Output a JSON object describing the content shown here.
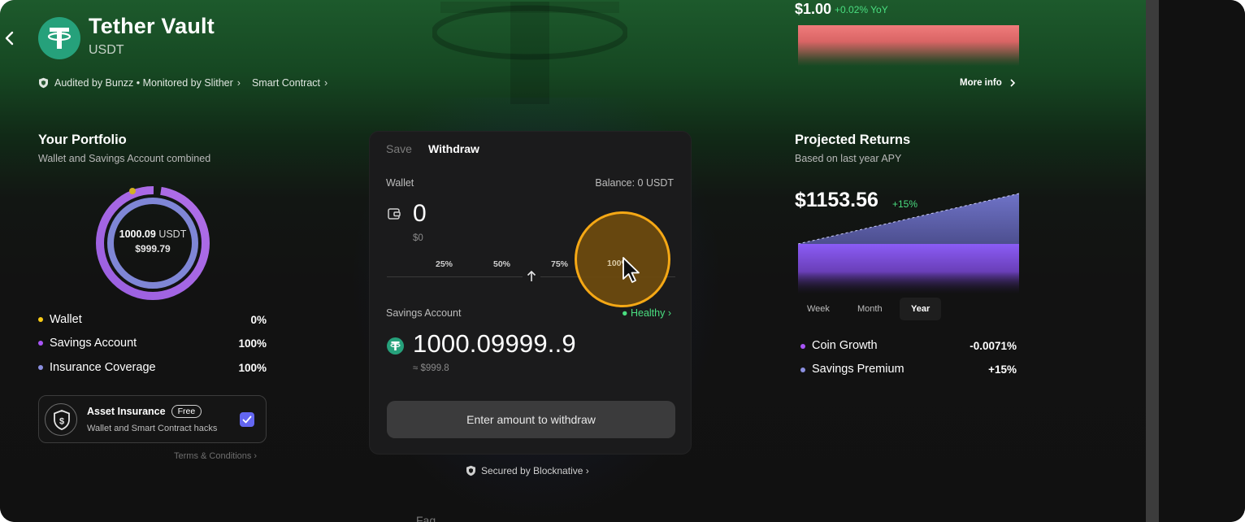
{
  "header": {
    "title": "Tether Vault",
    "subtitle": "USDT",
    "audit_text": "Audited by Bunzz • Monitored by Slither",
    "smart_contract_text": "Smart Contract"
  },
  "price": {
    "value": "$1.00",
    "change": "+0.02% YoY",
    "more_info": "More info"
  },
  "portfolio": {
    "title": "Your Portfolio",
    "subtitle": "Wallet and Savings Account combined",
    "total_amount": "1000.09",
    "total_unit": "USDT",
    "total_usd": "$999.79",
    "legend": [
      {
        "label": "Wallet",
        "value": "0%",
        "color": "#facc15"
      },
      {
        "label": "Savings Account",
        "value": "100%",
        "color": "#a855f7"
      },
      {
        "label": "Insurance Coverage",
        "value": "100%",
        "color": "#8b8fe0"
      }
    ],
    "insurance": {
      "title": "Asset Insurance",
      "badge": "Free",
      "subtitle": "Wallet and Smart Contract hacks",
      "checked": true
    },
    "terms": "Terms & Conditions ›"
  },
  "card": {
    "tabs": [
      "Save",
      "Withdraw"
    ],
    "active_tab": "Withdraw",
    "wallet_label": "Wallet",
    "balance": "Balance: 0 USDT",
    "wallet_amount": "0",
    "wallet_usd": "$0",
    "percent_options": [
      "25%",
      "50%",
      "75%",
      "100%"
    ],
    "savings_label": "Savings Account",
    "health_status": "● Healthy ›",
    "savings_amount": "1000.09999..9",
    "savings_usd": "≈ $999.8",
    "cta": "Enter amount to withdraw"
  },
  "secured": "Secured by Blocknative ›",
  "bottom_peek": "Faq",
  "projected": {
    "title": "Projected Returns",
    "subtitle": "Based on last year APY",
    "amount": "$1153.56",
    "change": "+15%",
    "ranges": [
      "Week",
      "Month",
      "Year"
    ],
    "active_range": "Year",
    "rows": [
      {
        "label": "Coin Growth",
        "value": "-0.0071%",
        "color": "#a855f7"
      },
      {
        "label": "Savings Premium",
        "value": "+15%",
        "color": "#8b8fe0"
      }
    ]
  },
  "colors": {
    "accent_green": "#4ade80",
    "tether_green": "#26a17b",
    "purple": "#a855f7",
    "indigo": "#6366f1",
    "cursor_highlight": "#f5a815"
  }
}
